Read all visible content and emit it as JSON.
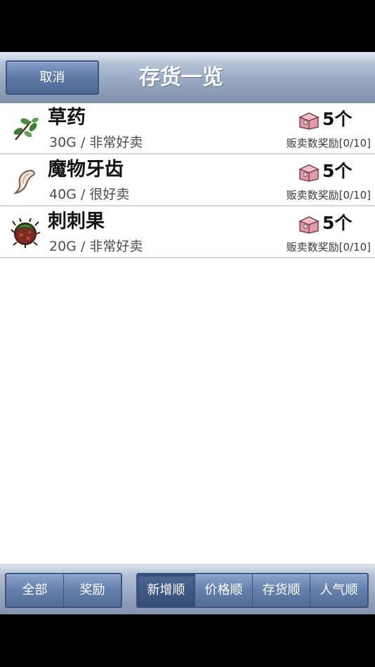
{
  "header": {
    "cancel_label": "取消",
    "title": "存货一览"
  },
  "items": [
    {
      "name": "草药",
      "detail": "30G / 非常好卖",
      "quantity": "5个",
      "reward": "贩卖数奖励[0/10]",
      "icon": "herb-icon"
    },
    {
      "name": "魔物牙齿",
      "detail": "40G / 很好卖",
      "quantity": "5个",
      "reward": "贩卖数奖励[0/10]",
      "icon": "fang-icon"
    },
    {
      "name": "刺刺果",
      "detail": "20G / 非常好卖",
      "quantity": "5个",
      "reward": "贩卖数奖励[0/10]",
      "icon": "spiky-fruit-icon"
    }
  ],
  "filter_tabs": [
    {
      "label": "全部",
      "active": false
    },
    {
      "label": "奖励",
      "active": false
    }
  ],
  "sort_tabs": [
    {
      "label": "新增顺",
      "active": true
    },
    {
      "label": "价格顺",
      "active": false
    },
    {
      "label": "存货顺",
      "active": false
    },
    {
      "label": "人气顺",
      "active": false
    }
  ],
  "colors": {
    "header_accent": "#7f90aa",
    "button": "#5f7aa6",
    "active_button": "#3f5884"
  }
}
